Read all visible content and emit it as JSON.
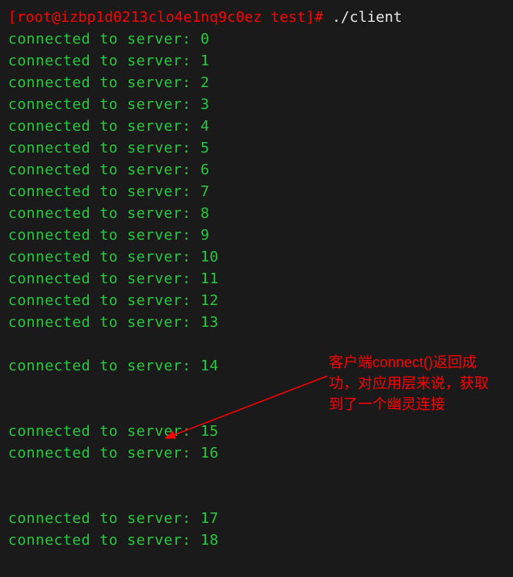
{
  "prompt": {
    "full": "[root@izbp1d0213clo4e1nq9c0ez test]# "
  },
  "command": "./client",
  "lines": {
    "prefix": "connected to server: "
  },
  "annotation": {
    "text": "客户端connect()返回成功，对应用层来说，获取到了一个幽灵连接"
  },
  "output_sequence": [
    "0",
    "1",
    "2",
    "3",
    "4",
    "5",
    "6",
    "7",
    "8",
    "9",
    "10",
    "11",
    "12",
    "13",
    "",
    "14",
    "",
    "",
    "15",
    "16",
    "",
    "",
    "17",
    "18"
  ]
}
